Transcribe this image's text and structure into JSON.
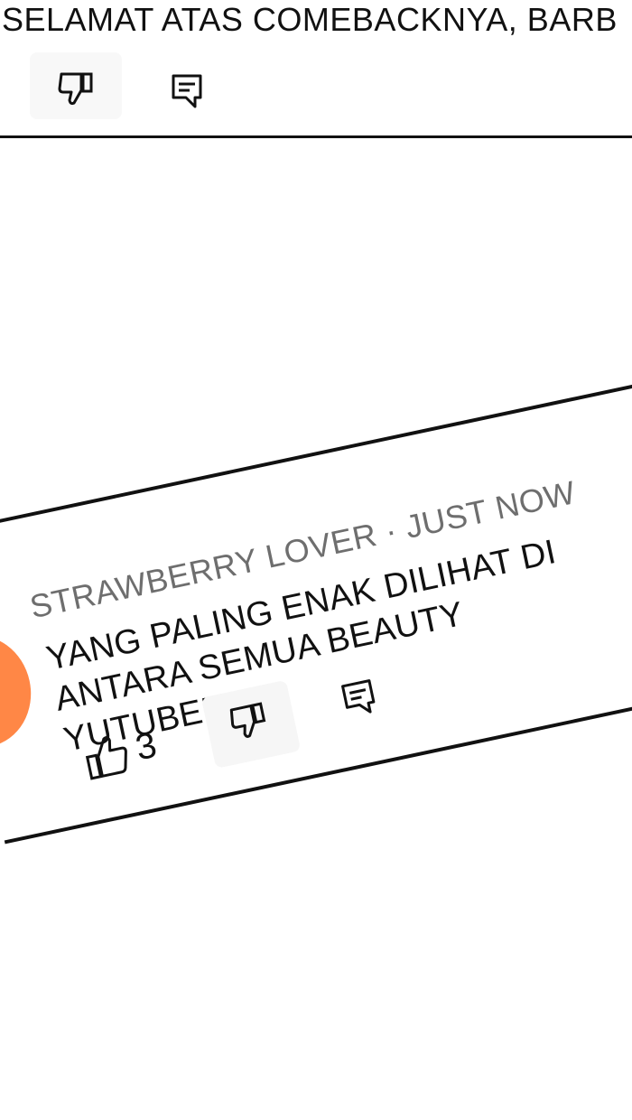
{
  "previous_comment": {
    "text": "SELAMAT ATAS COMEBACKNYA, BARB"
  },
  "comment": {
    "author": "STRAWBERRY LOVER",
    "separator": "·",
    "time": "JUST NOW",
    "text": "YANG PALING ENAK DILIHAT DI ANTARA SEMUA BEAUTY YUTUBERS",
    "like_count": "3",
    "avatar_color": "#ff8746"
  },
  "icons": {
    "like": "thumbs-up-icon",
    "dislike": "thumbs-down-icon",
    "reply": "reply-icon"
  }
}
